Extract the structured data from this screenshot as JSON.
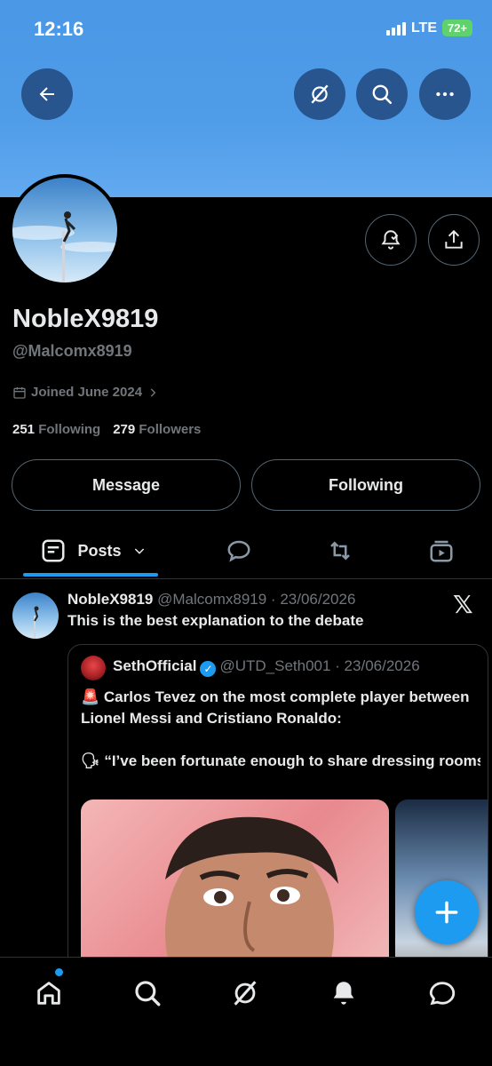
{
  "status_bar": {
    "time": "12:16",
    "network": "LTE",
    "battery": "72+"
  },
  "header": {
    "back_icon": "arrow-left-icon",
    "grok_icon": "grok-slash-icon",
    "search_icon": "search-icon",
    "more_icon": "more-horizontal-icon"
  },
  "profile": {
    "display_name": "NobleX9819",
    "handle": "@Malcomx8919",
    "joined": "Joined June 2024",
    "following_count": "251",
    "following_label": "Following",
    "followers_count": "279",
    "followers_label": "Followers",
    "message_button": "Message",
    "following_button": "Following"
  },
  "tabs": [
    {
      "label": "Posts",
      "icon": "posts-icon",
      "active": true
    },
    {
      "label": "",
      "icon": "replies-icon"
    },
    {
      "label": "",
      "icon": "reposts-icon"
    },
    {
      "label": "",
      "icon": "media-icon"
    }
  ],
  "post": {
    "author": "NobleX9819",
    "handle_date": "@Malcomx8919 · 23/06/2026",
    "text": "This is the best explanation to the debate",
    "quote": {
      "author": "SethOfficial",
      "handle_date": "@UTD_Seth001 · 23/06/2026",
      "line1_emoji": "🚨",
      "line1": "Carlos Tevez on the most complete player between Lionel Messi and Cristiano Ronaldo:",
      "line2_emoji": "🗣",
      "line2": "“I’ve been fortunate enough to share dressing rooms and battles with both Lionel Messi and Cr…"
    }
  },
  "colors": {
    "accent": "#1d9bf0",
    "banner": "#4f9ce8",
    "muted": "#71767b"
  }
}
